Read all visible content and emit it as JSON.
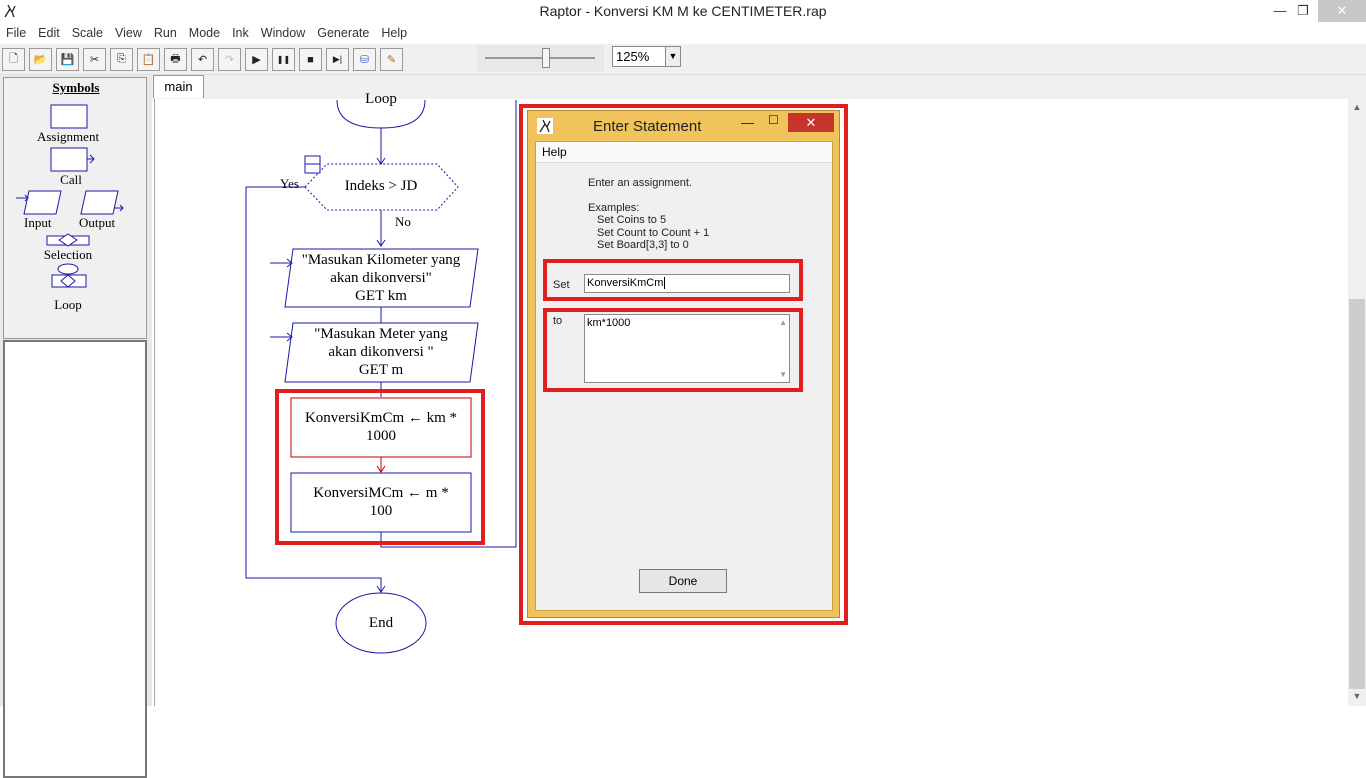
{
  "window": {
    "title": "Raptor - Konversi KM M ke CENTIMETER.rap",
    "min": "—",
    "max": "❐",
    "close": "✕"
  },
  "menu": [
    "File",
    "Edit",
    "Scale",
    "View",
    "Run",
    "Mode",
    "Ink",
    "Window",
    "Generate",
    "Help"
  ],
  "toolbar": {
    "buttons": [
      {
        "name": "new-file-icon",
        "glyph": "🗋"
      },
      {
        "name": "open-folder-icon",
        "glyph": "📂"
      },
      {
        "name": "save-icon",
        "glyph": "💾"
      },
      {
        "name": "cut-icon",
        "glyph": "✂"
      },
      {
        "name": "copy-icon",
        "glyph": "⎘"
      },
      {
        "name": "paste-icon",
        "glyph": "📋"
      },
      {
        "name": "print-icon",
        "glyph": "🖶"
      },
      {
        "name": "undo-icon",
        "glyph": "↶"
      },
      {
        "name": "redo-icon",
        "glyph": "↷"
      },
      {
        "name": "play-icon",
        "glyph": "▶"
      },
      {
        "name": "pause-icon",
        "glyph": "❚❚"
      },
      {
        "name": "stop-icon",
        "glyph": "■"
      },
      {
        "name": "step-icon",
        "glyph": "▶|"
      },
      {
        "name": "test-server-icon",
        "glyph": "⛁"
      },
      {
        "name": "pen-icon",
        "glyph": "✎"
      }
    ],
    "speed_level": 0.55,
    "zoom": "125%"
  },
  "symbols": {
    "title": "Symbols",
    "items": {
      "assignment": "Assignment",
      "call": "Call",
      "input": "Input",
      "output": "Output",
      "selection": "Selection",
      "loop": "Loop"
    }
  },
  "tab": "main",
  "flow": {
    "loop_label": "Loop",
    "condition": "Indeks > JD",
    "yes": "Yes",
    "no": "No",
    "input1": [
      "\"Masukan Kilometer yang",
      "akan dikonversi\"",
      "GET km"
    ],
    "input2": [
      "\"Masukan Meter yang",
      "akan dikonversi \"",
      "GET m"
    ],
    "assign1": [
      "KonversiKmCm ← km *",
      "1000"
    ],
    "assign2": [
      "KonversiMCm ← m *",
      "100"
    ],
    "end": "End"
  },
  "dialog": {
    "title": "Enter Statement",
    "help_menu": "Help",
    "hint_line": "Enter an assignment.",
    "examples_title": "Examples:",
    "examples": [
      "Set Coins to 5",
      "Set Count to Count + 1",
      "Set Board[3,3] to 0"
    ],
    "set_label": "Set",
    "set_value": "KonversiKmCm",
    "to_label": "to",
    "to_value": "km*1000",
    "done": "Done"
  },
  "colors": {
    "flow_blue": "#1a1aa8",
    "selected_red": "#c00000",
    "highlight_red": "#e0201f",
    "dialog_frame": "#f0c35c"
  }
}
